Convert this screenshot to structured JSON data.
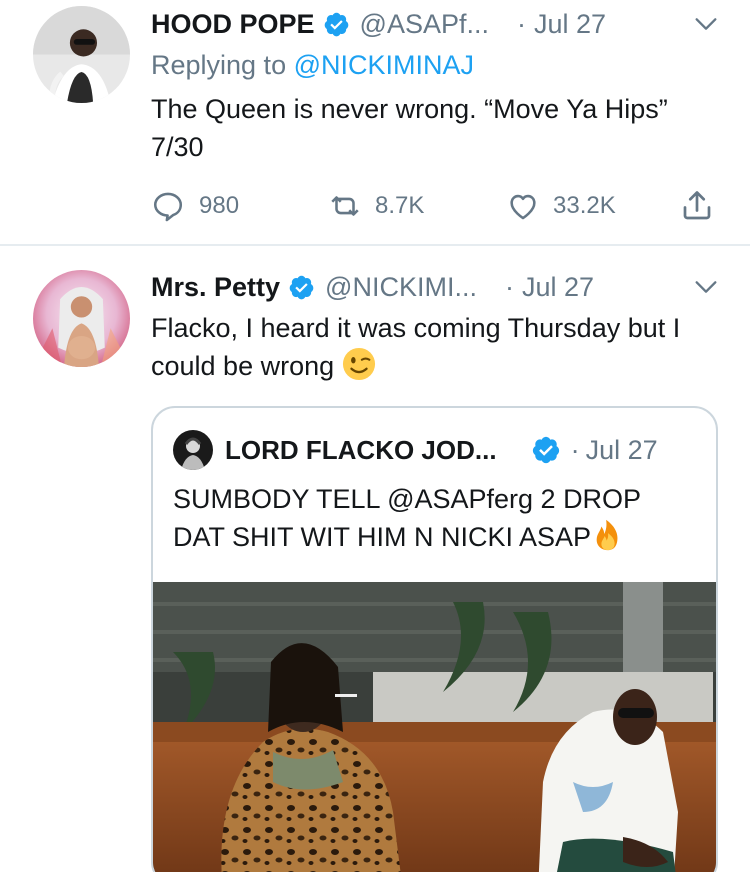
{
  "tweets": [
    {
      "name": "HOOD POPE",
      "handle": "@ASAPf...",
      "dot": "·",
      "time": "Jul 27",
      "reply_prefix": "Replying to ",
      "reply_to": "@NICKIMINAJ",
      "text": "The Queen is never wrong. “Move Ya Hips” 7/30",
      "replies": "980",
      "retweets": "8.7K",
      "likes": "33.2K",
      "verified": true
    },
    {
      "name": "Mrs. Petty",
      "handle": "@NICKIMI...",
      "dot": "·",
      "time": "Jul 27",
      "text": "Flacko, I heard it was coming Thursday but I could be wrong",
      "emoji": "winking-face",
      "verified": true,
      "quoted": {
        "name": "LORD FLACKO JOD...",
        "dot": "·",
        "time": "Jul 27",
        "text": "SUMBODY TELL @ASAPferg 2 DROP DAT SHIT WIT HIM N NICKI ASAP",
        "emoji": "fire",
        "verified": true
      }
    }
  ],
  "colors": {
    "accent": "#1da1f2",
    "secondary_text": "#657786",
    "primary_text": "#14171a",
    "divider": "#e6ecf0",
    "card_border": "#ccd6dd"
  },
  "icons": {
    "reply": "reply-icon",
    "retweet": "retweet-icon",
    "like": "heart-icon",
    "share": "share-icon",
    "caret": "chevron-down-icon",
    "verified": "verified-badge-icon"
  }
}
